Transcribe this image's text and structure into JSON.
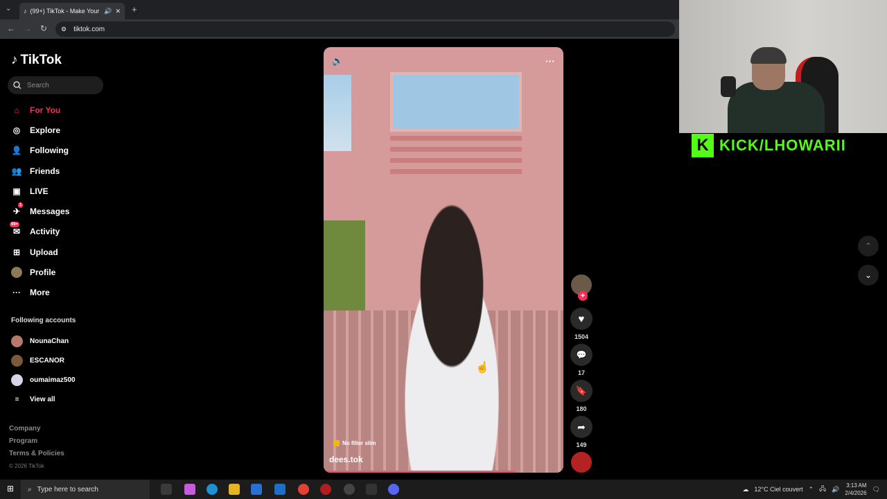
{
  "browser": {
    "tab_title": "(99+) TikTok - Make Your Day",
    "url": "tiktok.com"
  },
  "sidebar": {
    "logo": "TikTok",
    "search_placeholder": "Search",
    "nav": [
      {
        "label": "For You",
        "icon": "home-icon",
        "active": true
      },
      {
        "label": "Explore",
        "icon": "compass-icon"
      },
      {
        "label": "Following",
        "icon": "following-icon"
      },
      {
        "label": "Friends",
        "icon": "friends-icon"
      },
      {
        "label": "LIVE",
        "icon": "live-icon"
      },
      {
        "label": "Messages",
        "icon": "messages-icon",
        "badge": "1"
      },
      {
        "label": "Activity",
        "icon": "activity-icon",
        "badge": "99+"
      },
      {
        "label": "Upload",
        "icon": "upload-icon"
      },
      {
        "label": "Profile",
        "icon": "profile-avatar"
      },
      {
        "label": "More",
        "icon": "more-icon"
      }
    ],
    "following_title": "Following accounts",
    "following": [
      {
        "name": "NounaChan"
      },
      {
        "name": "ESCANOR"
      },
      {
        "name": "oumaimaz500"
      }
    ],
    "view_all": "View all",
    "footer": {
      "company": "Company",
      "program": "Program",
      "terms": "Terms & Policies",
      "copyright": "© 2026 TikTok"
    }
  },
  "video": {
    "caption_tag": "No filter slim",
    "author": "dees.tok",
    "progress": 0.8
  },
  "actions": {
    "likes": "1504",
    "comments": "17",
    "saves": "180",
    "shares": "149"
  },
  "overlay": {
    "kick_text": "KICK/LHOWARII"
  },
  "taskbar": {
    "search_placeholder": "Type here to search",
    "weather": "12°C  Ciel couvert",
    "time": "3:13 AM",
    "date": "2/4/2026"
  },
  "colors": {
    "accent": "#fe2c55",
    "kick": "#53fc18"
  }
}
